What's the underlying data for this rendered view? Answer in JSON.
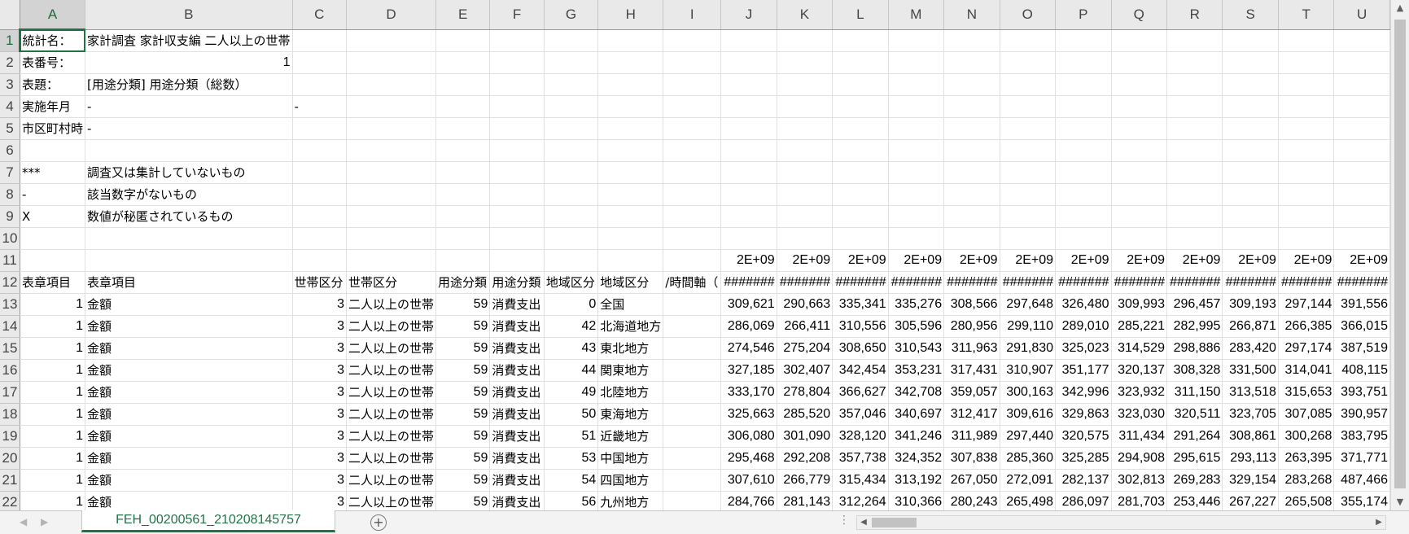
{
  "columns": [
    "A",
    "B",
    "C",
    "D",
    "E",
    "F",
    "G",
    "H",
    "I",
    "J",
    "K",
    "L",
    "M",
    "N",
    "O",
    "P",
    "Q",
    "R",
    "S",
    "T",
    "U"
  ],
  "rows": [
    {
      "n": "1",
      "cells": [
        {
          "c": 0,
          "v": "統計名："
        },
        {
          "c": 1,
          "v": "家計調査 家計収支編 二人以上の世帯"
        }
      ]
    },
    {
      "n": "2",
      "cells": [
        {
          "c": 0,
          "v": "表番号："
        },
        {
          "c": 1,
          "v": "1",
          "num": true
        }
      ]
    },
    {
      "n": "3",
      "cells": [
        {
          "c": 0,
          "v": "表題："
        },
        {
          "c": 1,
          "v": "[用途分類] 用途分類（総数）"
        }
      ]
    },
    {
      "n": "4",
      "cells": [
        {
          "c": 0,
          "v": "実施年月"
        },
        {
          "c": 1,
          "v": "-"
        },
        {
          "c": 2,
          "v": "-"
        }
      ]
    },
    {
      "n": "5",
      "cells": [
        {
          "c": 0,
          "v": "市区町村時",
          "clip": true
        },
        {
          "c": 1,
          "v": "-"
        }
      ]
    },
    {
      "n": "6",
      "cells": []
    },
    {
      "n": "7",
      "cells": [
        {
          "c": 0,
          "v": "***"
        },
        {
          "c": 1,
          "v": "調査又は集計していないもの"
        }
      ]
    },
    {
      "n": "8",
      "cells": [
        {
          "c": 0,
          "v": "-"
        },
        {
          "c": 1,
          "v": "該当数字がないもの"
        }
      ]
    },
    {
      "n": "9",
      "cells": [
        {
          "c": 0,
          "v": "X"
        },
        {
          "c": 1,
          "v": "数値が秘匿されているもの"
        }
      ]
    },
    {
      "n": "10",
      "cells": []
    },
    {
      "n": "11",
      "cells": [
        {
          "c": 9,
          "v": "2E+09",
          "num": true
        },
        {
          "c": 10,
          "v": "2E+09",
          "num": true
        },
        {
          "c": 11,
          "v": "2E+09",
          "num": true
        },
        {
          "c": 12,
          "v": "2E+09",
          "num": true
        },
        {
          "c": 13,
          "v": "2E+09",
          "num": true
        },
        {
          "c": 14,
          "v": "2E+09",
          "num": true
        },
        {
          "c": 15,
          "v": "2E+09",
          "num": true
        },
        {
          "c": 16,
          "v": "2E+09",
          "num": true
        },
        {
          "c": 17,
          "v": "2E+09",
          "num": true
        },
        {
          "c": 18,
          "v": "2E+09",
          "num": true
        },
        {
          "c": 19,
          "v": "2E+09",
          "num": true
        },
        {
          "c": 20,
          "v": "2E+09",
          "num": true
        }
      ]
    },
    {
      "n": "12",
      "cells": [
        {
          "c": 0,
          "v": "表章項目"
        },
        {
          "c": 1,
          "v": "表章項目"
        },
        {
          "c": 2,
          "v": "世帯区分"
        },
        {
          "c": 3,
          "v": "世帯区分"
        },
        {
          "c": 4,
          "v": "用途分類"
        },
        {
          "c": 5,
          "v": "用途分類"
        },
        {
          "c": 6,
          "v": "地域区分"
        },
        {
          "c": 7,
          "v": "地域区分"
        },
        {
          "c": 8,
          "v": "/時間軸（",
          "clip": true
        },
        {
          "c": 9,
          "v": "#######",
          "num": true
        },
        {
          "c": 10,
          "v": "#######",
          "num": true
        },
        {
          "c": 11,
          "v": "#######",
          "num": true
        },
        {
          "c": 12,
          "v": "#######",
          "num": true
        },
        {
          "c": 13,
          "v": "#######",
          "num": true
        },
        {
          "c": 14,
          "v": "#######",
          "num": true
        },
        {
          "c": 15,
          "v": "#######",
          "num": true
        },
        {
          "c": 16,
          "v": "#######",
          "num": true
        },
        {
          "c": 17,
          "v": "#######",
          "num": true
        },
        {
          "c": 18,
          "v": "#######",
          "num": true
        },
        {
          "c": 19,
          "v": "#######",
          "num": true
        },
        {
          "c": 20,
          "v": "#######",
          "num": true
        }
      ]
    },
    {
      "n": "13",
      "region": "全国",
      "g": "0",
      "vals": [
        "309,621",
        "290,663",
        "335,341",
        "335,276",
        "308,566",
        "297,648",
        "326,480",
        "309,993",
        "296,457",
        "309,193",
        "297,144",
        "391,556"
      ]
    },
    {
      "n": "14",
      "region": "北海道地方",
      "g": "42",
      "vals": [
        "286,069",
        "266,411",
        "310,556",
        "305,596",
        "280,956",
        "299,110",
        "289,010",
        "285,221",
        "282,995",
        "266,871",
        "266,385",
        "366,015"
      ]
    },
    {
      "n": "15",
      "region": "東北地方",
      "g": "43",
      "vals": [
        "274,546",
        "275,204",
        "308,650",
        "310,543",
        "311,963",
        "291,830",
        "325,023",
        "314,529",
        "298,886",
        "283,420",
        "297,174",
        "387,519"
      ]
    },
    {
      "n": "16",
      "region": "関東地方",
      "g": "44",
      "vals": [
        "327,185",
        "302,407",
        "342,454",
        "353,231",
        "317,431",
        "310,907",
        "351,177",
        "320,137",
        "308,328",
        "331,500",
        "314,041",
        "408,115"
      ]
    },
    {
      "n": "17",
      "region": "北陸地方",
      "g": "49",
      "vals": [
        "333,170",
        "278,804",
        "366,627",
        "342,708",
        "359,057",
        "300,163",
        "342,996",
        "323,932",
        "311,150",
        "313,518",
        "315,653",
        "393,751"
      ]
    },
    {
      "n": "18",
      "region": "東海地方",
      "g": "50",
      "vals": [
        "325,663",
        "285,520",
        "357,046",
        "340,697",
        "312,417",
        "309,616",
        "329,863",
        "323,030",
        "320,511",
        "323,705",
        "307,085",
        "390,957"
      ]
    },
    {
      "n": "19",
      "region": "近畿地方",
      "g": "51",
      "vals": [
        "306,080",
        "301,090",
        "328,120",
        "341,246",
        "311,989",
        "297,440",
        "320,575",
        "311,434",
        "291,264",
        "308,861",
        "300,268",
        "383,795"
      ]
    },
    {
      "n": "20",
      "region": "中国地方",
      "g": "53",
      "vals": [
        "295,468",
        "292,208",
        "357,738",
        "324,352",
        "307,838",
        "285,360",
        "325,285",
        "294,908",
        "295,615",
        "293,113",
        "263,395",
        "371,771"
      ]
    },
    {
      "n": "21",
      "region": "四国地方",
      "g": "54",
      "vals": [
        "307,610",
        "266,779",
        "315,434",
        "313,192",
        "267,050",
        "272,091",
        "282,137",
        "302,813",
        "269,283",
        "329,154",
        "283,268",
        "487,466"
      ]
    },
    {
      "n": "22",
      "region": "九州地方",
      "g": "56",
      "vals": [
        "284,766",
        "281,143",
        "312,264",
        "310,366",
        "280,243",
        "265,498",
        "286,097",
        "281,703",
        "253,446",
        "267,227",
        "265,508",
        "355,174"
      ]
    }
  ],
  "data_row_fixed": {
    "a": "1",
    "b": "金額",
    "c": "3",
    "d": "二人以上の世帯",
    "e": "59",
    "f": "消費支出"
  },
  "sheet_tab": "FEH_00200561_210208145757",
  "add_sheet_symbol": "+",
  "dots_symbol": "⋮"
}
